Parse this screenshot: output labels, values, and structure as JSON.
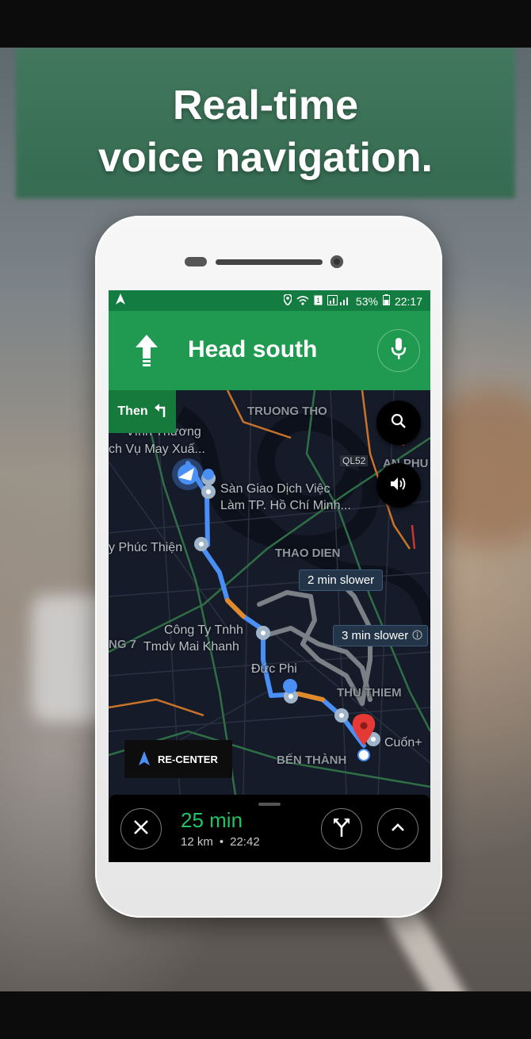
{
  "promo": {
    "line1": "Real-time",
    "line2": "voice navigation."
  },
  "status_bar": {
    "battery": "53%",
    "time": "22:17"
  },
  "navigation": {
    "instruction": "Head south",
    "then_label": "Then"
  },
  "map": {
    "labels": {
      "truong_tho": "TRUONG THO",
      "vinh_thuong": "Vĩnh Thương",
      "vu_may_xua": "ch Vụ May Xuấ...",
      "ql52": "QL52",
      "an_phu": "AN PHU",
      "san_giao_1": "Sàn Giao Dịch Việc",
      "san_giao_2": "Làm TP. Hồ Chí Minh...",
      "phuc_thien": "y Phúc Thiện",
      "thao_dien": "THAO DIEN",
      "cong_ty_1": "Công Ty Tnhh",
      "cong_ty_2": "Tmdv Mai Khanh",
      "ng7": "NG 7",
      "duc_phi": "Đức Phi",
      "thu_thiem": "THU THIEM",
      "cuon": "Cuốn+",
      "ben_thanh": "BẾN THÀNH"
    },
    "chips": {
      "alt1": "2 min slower",
      "alt2": "3 min slower"
    },
    "recenter_label": "RE-CENTER"
  },
  "trip": {
    "eta_duration": "25 min",
    "distance": "12 km",
    "separator": "•",
    "arrival_time": "22:42"
  },
  "colors": {
    "nav_green": "#1f9a50",
    "status_green": "#137c40",
    "route_blue": "#4a8ff5",
    "eta_green": "#21c365",
    "destination_red": "#e53935"
  }
}
